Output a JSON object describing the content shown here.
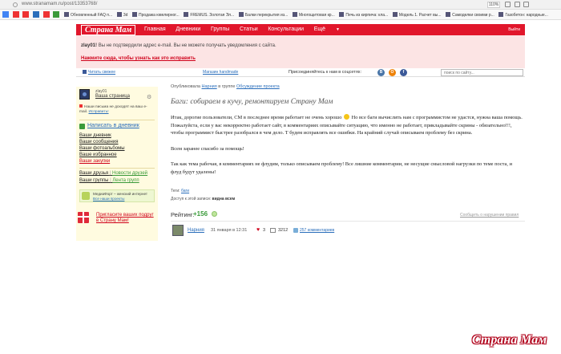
{
  "browser": {
    "url": "www.stranamam.ru/post/13353768/",
    "zoom": "110%",
    "bookmarks": [
      "Обновленный FAQ п...",
      "3d",
      "Продажа ювелирног...",
      "FREMUS. Золотая Эл...",
      "Балки перекрытия из...",
      "Многощитовая кр...",
      "Печь из кирпича: кла...",
      "Модель 1. Расчет вы...",
      "Самоделки своими р...",
      "Газобетон: народные..."
    ]
  },
  "header": {
    "logo": "Страна Мам",
    "nav": [
      "Главная",
      "Дневники",
      "Группы",
      "Статьи",
      "Консультации",
      "Ещё"
    ],
    "logout": "Выйти"
  },
  "warning": {
    "user": "zlay01!",
    "text": "Вы не подтвердили адрес e-mail. Вы не можете получать уведомления с сайта.",
    "link": "Нажмите сюда, чтобы узнать как это исправить"
  },
  "toolbar": {
    "read_fresh": "Читать свежее",
    "shop": "Магазин handmade",
    "join": "Присоединяйтесь к нам в соцсетях:",
    "social": [
      "В",
      "О",
      "f"
    ],
    "search_placeholder": "поиск по сайту..."
  },
  "sidebar": {
    "username": "zlay01",
    "my_page": "Ваша страница",
    "email_warn": "Наши письма не доходят на ваш e-mail.",
    "email_fix": "Исправить!",
    "write": "Написать в дневник",
    "links": [
      "Ваши дневник",
      "Ваши сообщения",
      "Ваши фотоальбомы",
      "Ваше избранное",
      "Ваши закупки"
    ],
    "friends": "Ваши друзья",
    "friends_news": "Новости друзей",
    "groups": "Ваши группы",
    "groups_feed": "Лента групп",
    "mh_title": "МедиаФорт – женский интернет",
    "mh_link": "Все наши проекты",
    "invite": "Пригласите ваших подруг в Страну Мам!"
  },
  "post": {
    "pub_prefix": "Опубликовала",
    "author": "Нарния",
    "pub_mid": "в группе",
    "group": "Обсуждение проекта",
    "title": "Баги: собираем в кучу, ремонтируем Страну Мам",
    "p1a": "Итак, дорогие пользователи, СМ в последнее время работает не очень хорошо",
    "p1b": "Но все баги вычислить нам с программистом не удастся, нужна ваша помощь. Пожалуйста, если у вас некорректно работает сайт, в комментариях описывайте ситуацию, что именно не работает, прикладывайте скрины - обязательно!!!, чтобы программист быстрее разобрался в чем дело. Т будем исправлять все ошибки. На крайний случай описываем проблему без скрина.",
    "p2": "Всем заранее спасибо за помощь!",
    "p3": "Так как тема рабочая, в комментариях не флудим, только описываем проблему! Все лишние комментарии, не несущие смысловой нагрузки по теме поста, и флуд будут удалены!",
    "tags_label": "Теги:",
    "tag": "баги",
    "access_label": "Доступ к этой записи:",
    "access_value": "видна всем",
    "rating_label": "Рейтинг:",
    "rating": "+156",
    "report": "Сообщить о нарушении правил",
    "author_name": "Нарния",
    "date": "31 января в 12:31",
    "likes": "3",
    "views": "3212",
    "comments": "257 комментариев"
  },
  "watermark": "Страна Мам"
}
